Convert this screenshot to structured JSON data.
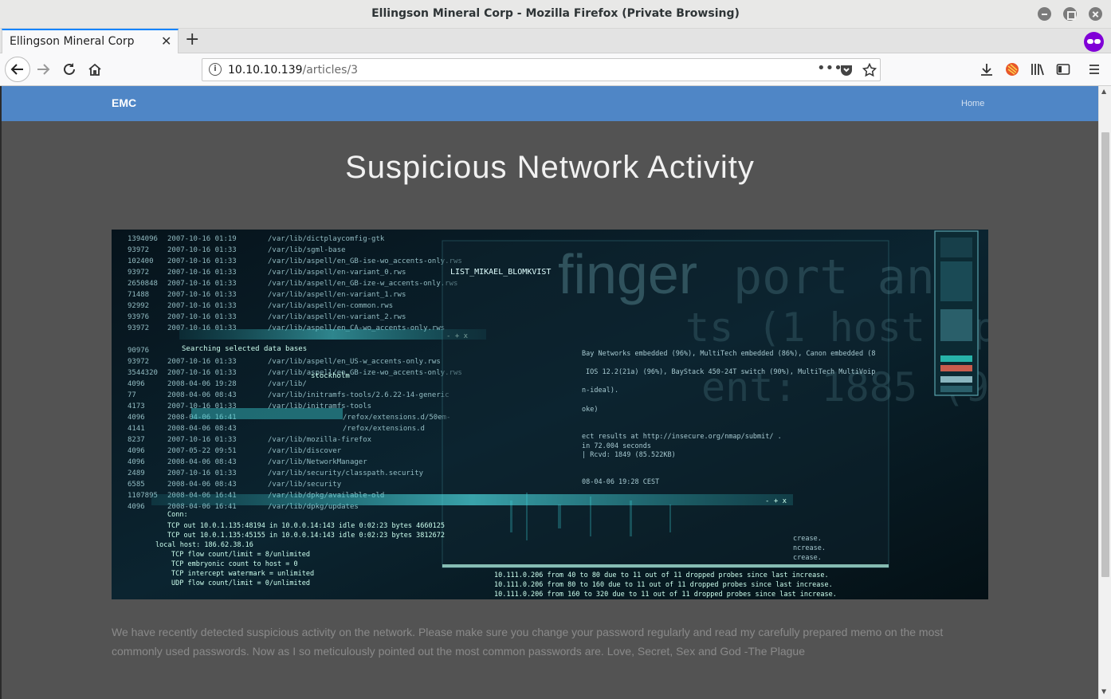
{
  "window": {
    "title": "Ellingson Mineral Corp - Mozilla Firefox (Private Browsing)"
  },
  "tabs": [
    {
      "label": "Ellingson Mineral Corp",
      "close": "✕"
    }
  ],
  "new_tab": "+",
  "url": {
    "host": "10.10.10.139",
    "path": "/articles/3"
  },
  "site": {
    "brand": "EMC",
    "nav_home": "Home",
    "article_title": "Suspicious Network Activity",
    "article_body": "We have recently detected suspicious activity on the network. Please make sure you change your password regularly and read my carefully prepared memo on the most commonly used passwords. Now as I so meticulously pointed out the most common passwords are. Love, Secret, Sex and God -The Plague"
  },
  "hero_text": {
    "line_a": "/var/lib/initramfs-tools/2.6.22-14-generic",
    "line_b": "LIST_MIKAEL_BLOMKVIST",
    "line_c": "Bay Networks embedded (96%), MultiTech embedded (86%), Canon embedded (8",
    "line_d": "IOS 12.2(21a) (96%), BayStack 450-24T switch (90%), MultiTech MultiVoip",
    "line_e": "ect results at http://insecure.org/nmap/submit/ .",
    "line_f": "in 72.004 seconds",
    "line_g": "| Rcvd: 1849 (85.522KB)",
    "line_h": "08-04-06 19:28 CEST",
    "line_i": "10.111.0.206 from 40 to 80 due to 11 out of 11 dropped probes since last increase.",
    "line_j": "10.111.0.206 from 80 to 160 due to 11 out of 11 dropped probes since last increase.",
    "line_k": "10.111.0.206 from 160 to 320 due to 11 out of 11 dropped probes since last increase.",
    "line_l": "TCP flow count/limit = 8/unlimited",
    "line_m": "TCP embryonic count to host = 0",
    "line_n": "TCP intercept watermark = unlimited",
    "line_o": "UDP flow count/limit = 0/unlimited",
    "line_p": "local host: 186.62.38.16",
    "line_q": "Searching selected data bases",
    "line_r": "stockholm",
    "finger": "finger",
    "big_a": "port an",
    "big_b": "ts (1 host up)",
    "big_c": "ent: 1885 (9"
  },
  "colors": {
    "nav_blue": "#4f86c6",
    "page_bg": "#535353",
    "private": "#8000d7"
  }
}
